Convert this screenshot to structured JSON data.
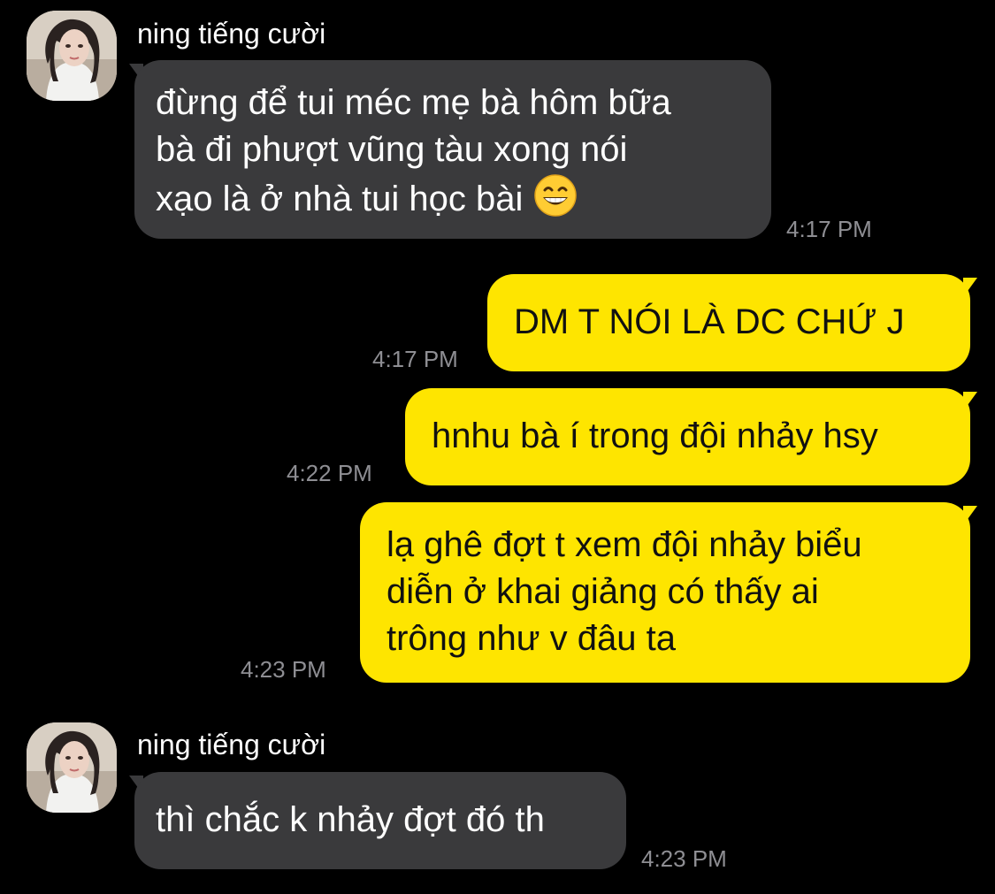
{
  "colors": {
    "background": "#000000",
    "incoming_bubble": "#3a3a3c",
    "outgoing_bubble": "#fee500",
    "timestamp": "#8e8e93"
  },
  "messages": [
    {
      "direction": "incoming",
      "sender": "ning tiếng cười",
      "avatar_icon": "profile-photo",
      "lines": [
        "đừng để tui méc mẹ bà hôm bữa",
        "bà đi phượt vũng tàu xong nói",
        "xạo là ở nhà tui học bài"
      ],
      "emoji": "grinning-face-with-smiling-eyes",
      "time": "4:17 PM"
    },
    {
      "direction": "outgoing",
      "lines": [
        "DM T NÓI LÀ DC CHỨ J"
      ],
      "time": "4:17 PM"
    },
    {
      "direction": "outgoing",
      "lines": [
        "hnhu bà í trong đội nhảy hsy"
      ],
      "time": "4:22 PM"
    },
    {
      "direction": "outgoing",
      "lines": [
        "lạ ghê đợt t xem đội nhảy biểu",
        "diễn ở khai giảng có thấy ai",
        "trông như v đâu ta"
      ],
      "time": "4:23 PM"
    },
    {
      "direction": "incoming",
      "sender": "ning tiếng cười",
      "avatar_icon": "profile-photo",
      "lines": [
        "thì chắc k nhảy đợt đó th"
      ],
      "time": "4:23 PM"
    }
  ]
}
